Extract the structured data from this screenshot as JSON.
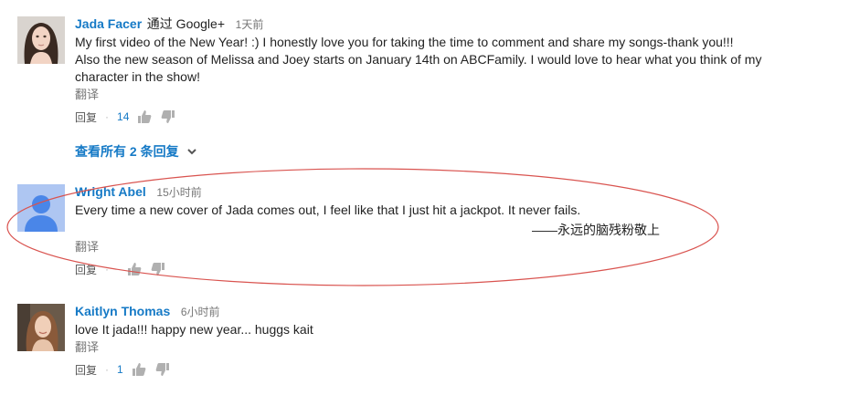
{
  "comments": [
    {
      "author": "Jada Facer",
      "via": "通过 Google+",
      "time": "1天前",
      "lines": [
        "My first video of the New Year!  :)  I honestly love you for taking the time to comment and share my songs-thank you!!!",
        "Also the new season of Melissa and Joey starts on January 14th on ABCFamily.  I would love to hear what you think of my",
        "character in the show!"
      ],
      "translate": "翻译",
      "reply": "回复",
      "likes": "14"
    },
    {
      "author": "Wright Abel",
      "time": "15小时前",
      "lines": [
        "Every time a new cover of Jada comes out, I feel like that I just hit a jackpot. It never fails."
      ],
      "translate": "翻译",
      "reply": "回复"
    },
    {
      "author": "Kaitlyn Thomas",
      "time": "6小时前",
      "lines": [
        "love It jada!!! happy new year... huggs kait"
      ],
      "translate": "翻译",
      "reply": "回复",
      "likes": "1"
    }
  ],
  "view_replies": "查看所有 2 条回复",
  "annotation": {
    "signature": "——永远的脑残粉敬上",
    "oval_color": "#d9534f"
  },
  "colors": {
    "link": "#167ac6",
    "meta": "#767676"
  },
  "icons": [
    "thumbs-up-icon",
    "thumbs-down-icon",
    "chevron-down-icon",
    "default-avatar-icon"
  ]
}
